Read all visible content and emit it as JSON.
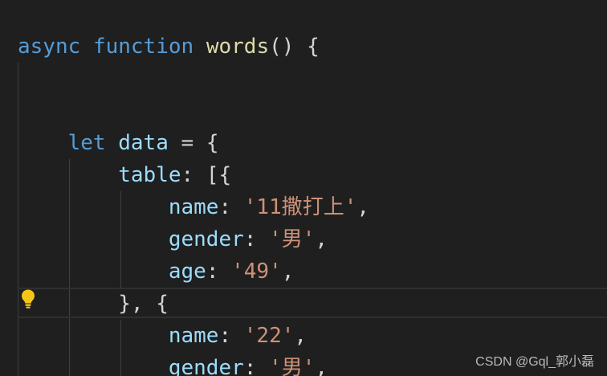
{
  "code_lines": [
    {
      "tokens": [
        [
          "async",
          "keyword"
        ],
        [
          " ",
          "punc"
        ],
        [
          "function",
          "keyword"
        ],
        [
          " ",
          "punc"
        ],
        [
          "words",
          "fn"
        ],
        [
          "()",
          "punc"
        ],
        [
          " {",
          "punc"
        ]
      ]
    },
    {
      "tokens": []
    },
    {
      "tokens": []
    },
    {
      "tokens": [
        [
          "    ",
          "punc"
        ],
        [
          "let",
          "keyword"
        ],
        [
          " ",
          "punc"
        ],
        [
          "data",
          "var"
        ],
        [
          " = {",
          "punc"
        ]
      ]
    },
    {
      "tokens": [
        [
          "        ",
          "punc"
        ],
        [
          "table",
          "prop"
        ],
        [
          ": [{",
          "punc"
        ]
      ]
    },
    {
      "tokens": [
        [
          "            ",
          "punc"
        ],
        [
          "name",
          "prop"
        ],
        [
          ": ",
          "punc"
        ],
        [
          "'11撒打上'",
          "str"
        ],
        [
          ",",
          "punc"
        ]
      ]
    },
    {
      "tokens": [
        [
          "            ",
          "punc"
        ],
        [
          "gender",
          "prop"
        ],
        [
          ": ",
          "punc"
        ],
        [
          "'男'",
          "str"
        ],
        [
          ",",
          "punc"
        ]
      ]
    },
    {
      "tokens": [
        [
          "            ",
          "punc"
        ],
        [
          "age",
          "prop"
        ],
        [
          ": ",
          "punc"
        ],
        [
          "'49'",
          "str"
        ],
        [
          ",",
          "punc"
        ]
      ]
    },
    {
      "tokens": [
        [
          "        ",
          "punc"
        ],
        [
          "}, {",
          "punc"
        ]
      ]
    },
    {
      "tokens": [
        [
          "            ",
          "punc"
        ],
        [
          "name",
          "prop"
        ],
        [
          ": ",
          "punc"
        ],
        [
          "'22'",
          "str"
        ],
        [
          ",",
          "punc"
        ]
      ]
    },
    {
      "tokens": [
        [
          "            ",
          "punc"
        ],
        [
          "gender",
          "prop"
        ],
        [
          ": ",
          "punc"
        ],
        [
          "'男'",
          "str"
        ],
        [
          ",",
          "punc"
        ]
      ]
    }
  ],
  "lightbulb_icon": "lightbulb-icon",
  "watermark": "CSDN @Gql_郭小磊",
  "colors": {
    "background": "#1f1f1f",
    "keyword": "#569cd6",
    "function": "#dcdcaa",
    "property": "#9cdcfe",
    "string": "#ce9178",
    "punctuation": "#d4d4d4",
    "lightbulb": "#f5c518"
  }
}
